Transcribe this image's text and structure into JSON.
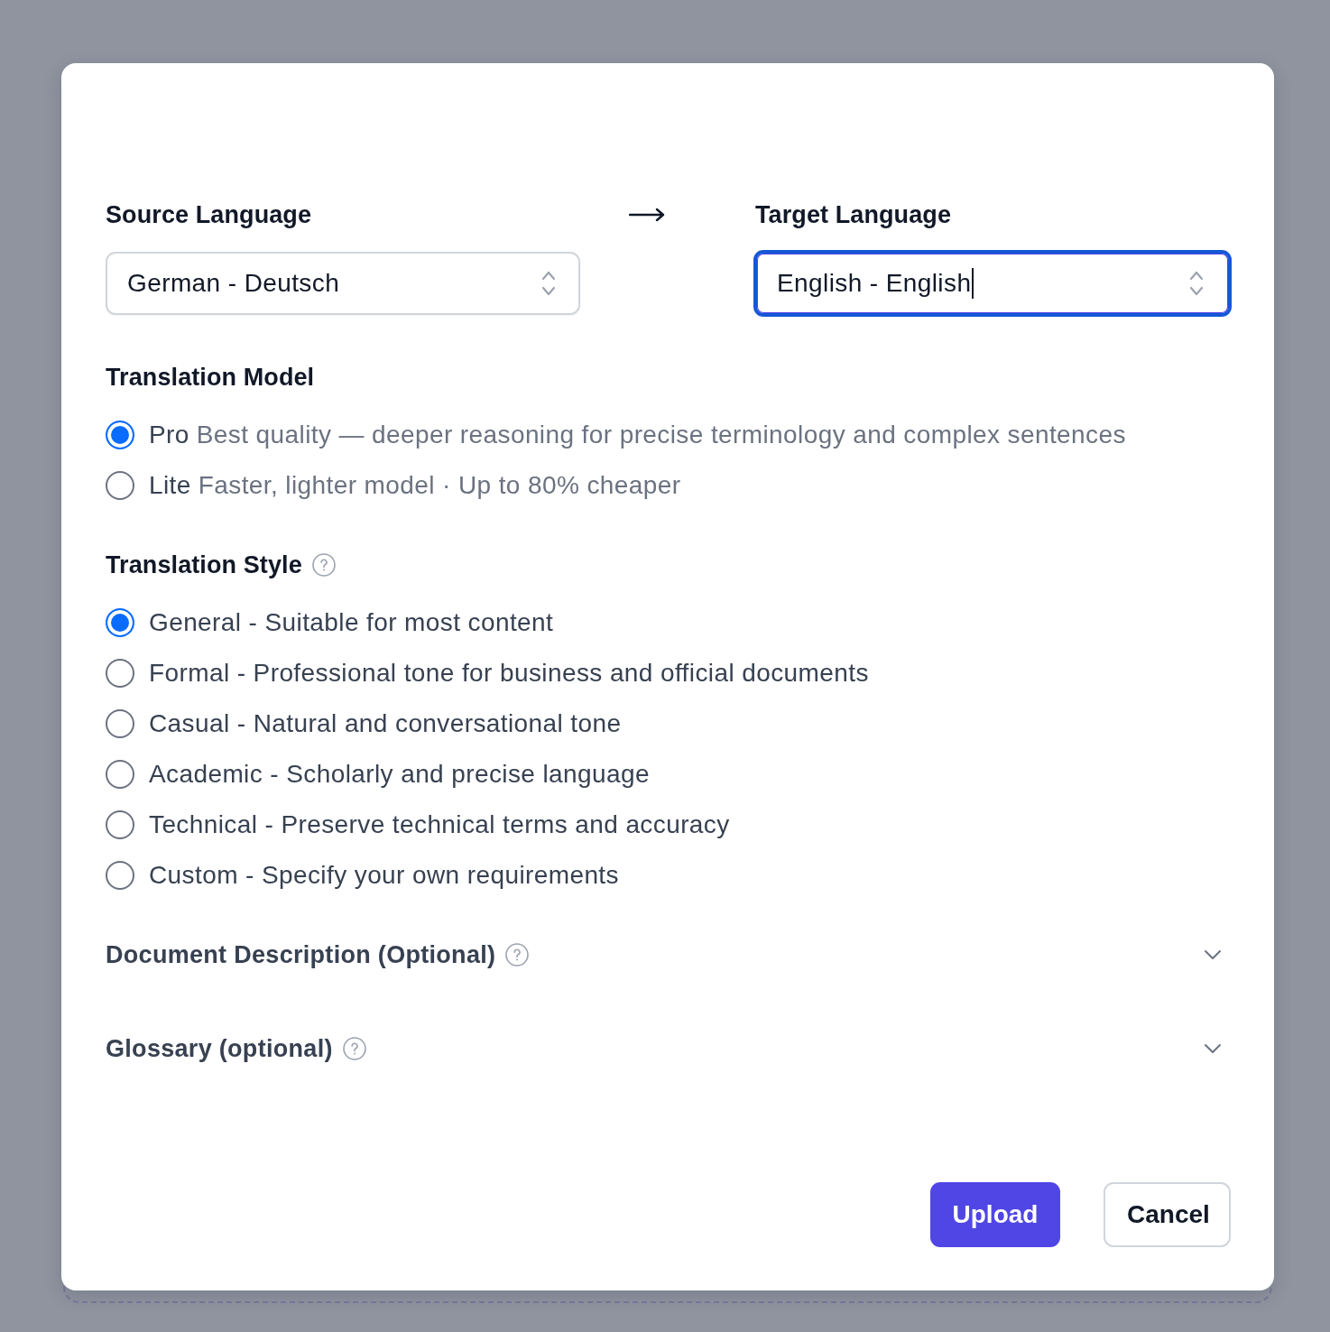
{
  "language_fields": [
    {
      "label": "Source Language",
      "value": "German - Deutsch",
      "focused": false
    },
    {
      "label": "Target Language",
      "value": "English - English",
      "focused": true
    }
  ],
  "translation_model": {
    "label": "Translation Model",
    "options": [
      {
        "name": "Pro",
        "description": "Best quality — deeper reasoning for precise terminology and complex sentences",
        "selected": true
      },
      {
        "name": "Lite",
        "description": "Faster, lighter model · Up to 80% cheaper",
        "selected": false
      }
    ]
  },
  "translation_style": {
    "label": "Translation Style",
    "options": [
      {
        "label": "General - Suitable for most content",
        "selected": true
      },
      {
        "label": "Formal - Professional tone for business and official documents",
        "selected": false
      },
      {
        "label": "Casual - Natural and conversational tone",
        "selected": false
      },
      {
        "label": "Academic - Scholarly and precise language",
        "selected": false
      },
      {
        "label": "Technical - Preserve technical terms and accuracy",
        "selected": false
      },
      {
        "label": "Custom - Specify your own requirements",
        "selected": false
      }
    ]
  },
  "sections": [
    {
      "title": "Document Description (Optional)",
      "expanded": false
    },
    {
      "title": "Glossary (optional)",
      "expanded": false
    }
  ],
  "buttons": [
    {
      "label": "Upload",
      "kind": "primary"
    },
    {
      "label": "Cancel",
      "kind": "secondary"
    }
  ]
}
